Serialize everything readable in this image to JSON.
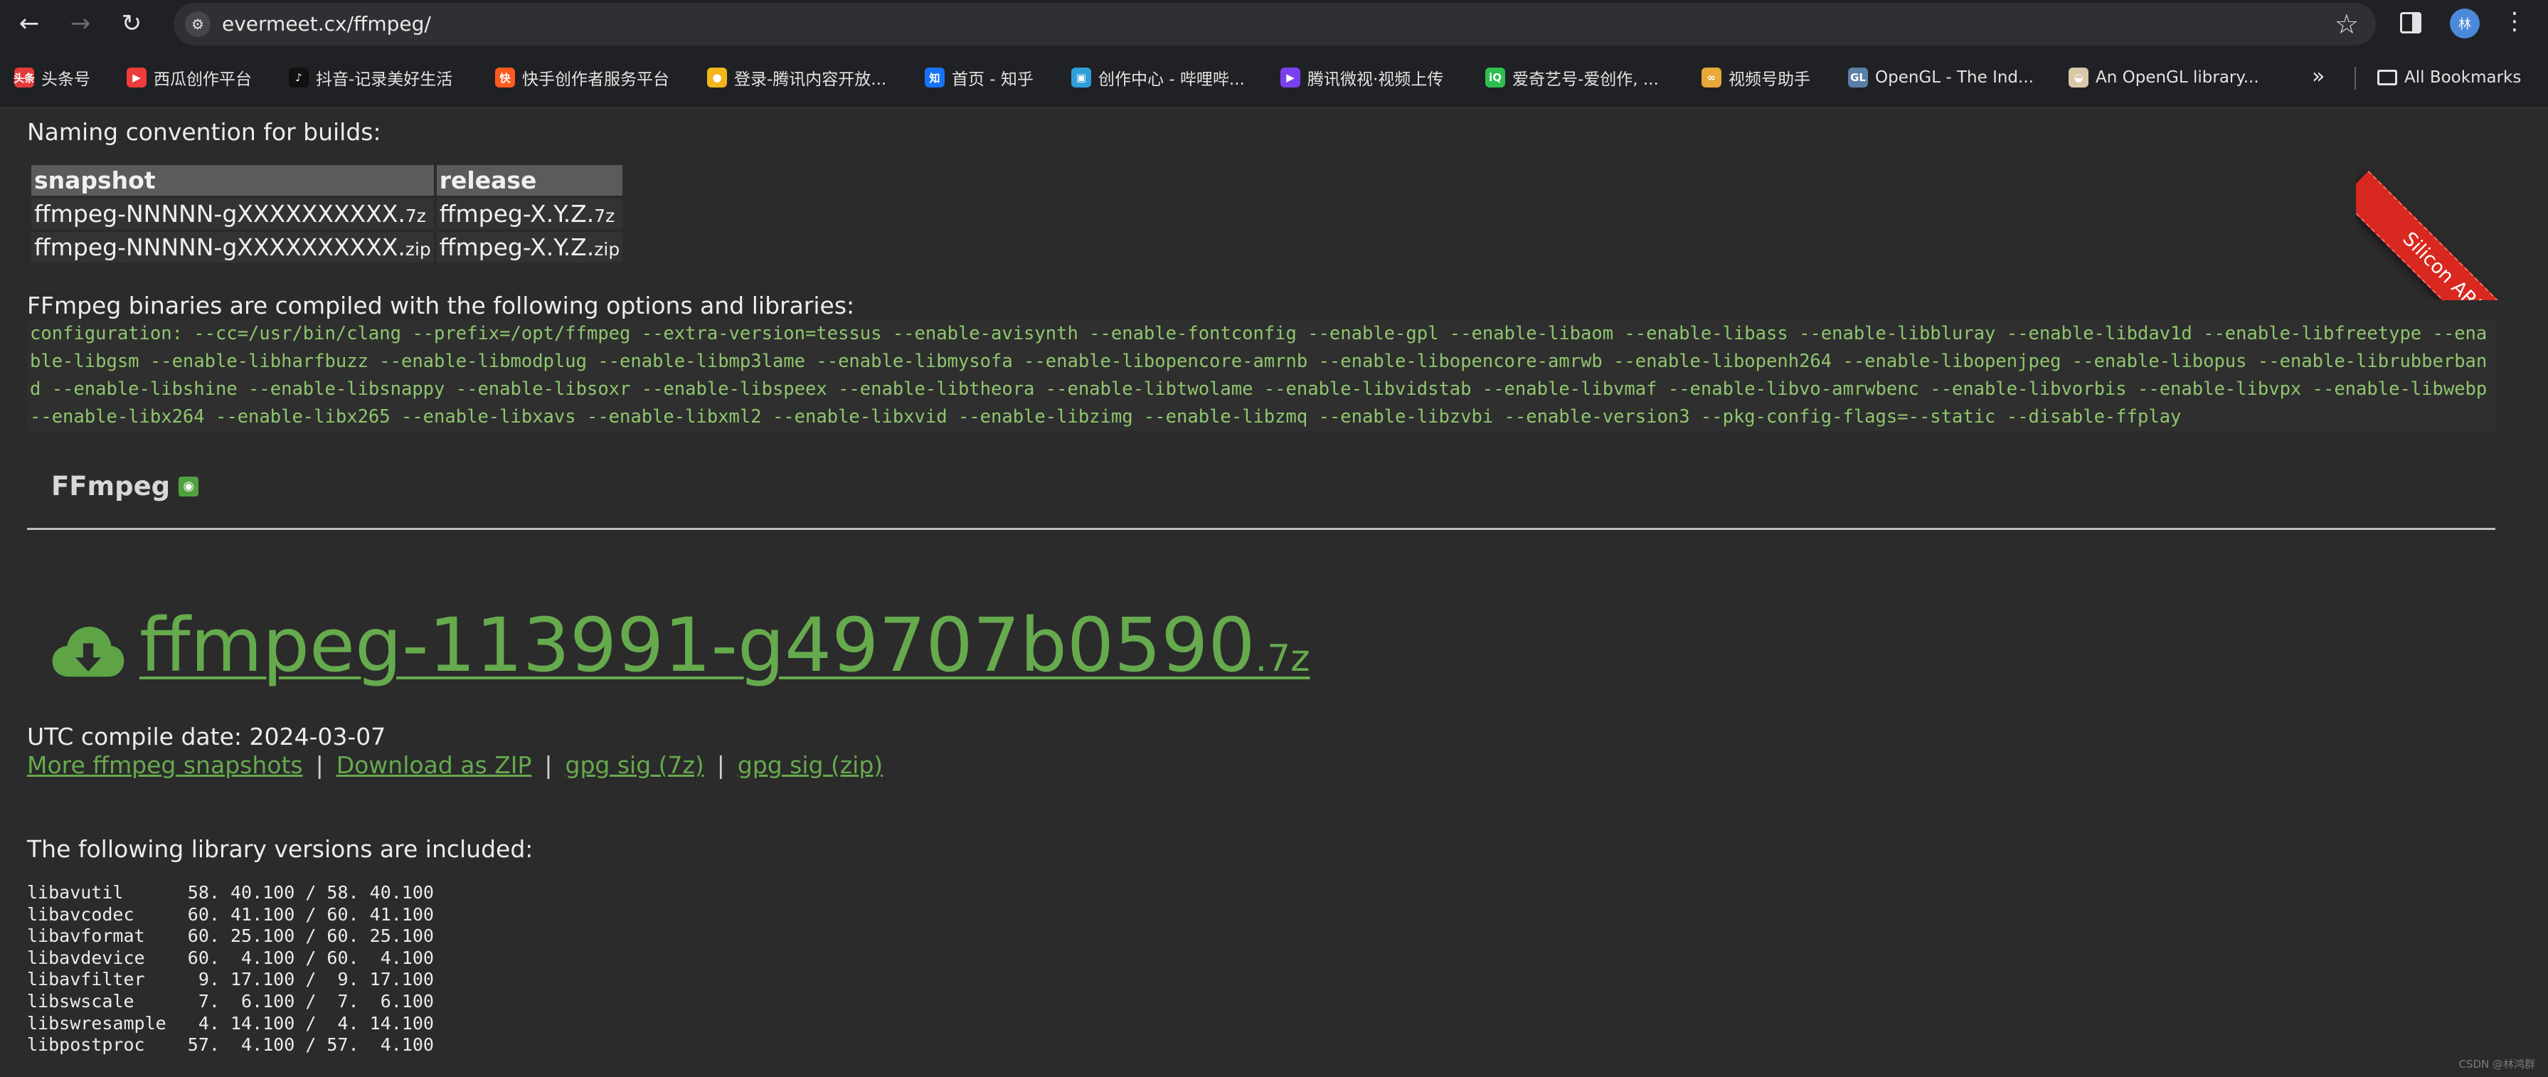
{
  "browser": {
    "url": "evermeet.cx/ffmpeg/",
    "avatar_initial": "林",
    "bookmarks": [
      {
        "label": "头条号",
        "icon": "toutiao-icon",
        "badge": "头条",
        "color": "#e33b3b"
      },
      {
        "label": "西瓜创作平台",
        "icon": "xigua-icon",
        "badge": "▶",
        "color": "#ee3c3c"
      },
      {
        "label": "抖音-记录美好生活",
        "icon": "douyin-icon",
        "badge": "♪",
        "color": "#111111"
      },
      {
        "label": "快手创作者服务平台",
        "icon": "kuaishou-icon",
        "badge": "快",
        "color": "#ff5a1f"
      },
      {
        "label": "登录-腾讯内容开放...",
        "icon": "tencent-bell-icon",
        "badge": "●",
        "color": "#f2b51b"
      },
      {
        "label": "首页 - 知乎",
        "icon": "zhihu-icon",
        "badge": "知",
        "color": "#1772f6"
      },
      {
        "label": "创作中心 - 哔哩哔...",
        "icon": "bilibili-icon",
        "badge": "▣",
        "color": "#2e9fd8"
      },
      {
        "label": "腾讯微视·视频上传",
        "icon": "weishi-icon",
        "badge": "▶",
        "color": "#7b3ff2"
      },
      {
        "label": "爱奇艺号-爱创作, ...",
        "icon": "iqiyi-icon",
        "badge": "iQ",
        "color": "#2fbf4f"
      },
      {
        "label": "视频号助手",
        "icon": "channels-icon",
        "badge": "∞",
        "color": "#e6a93a"
      },
      {
        "label": "OpenGL - The Ind...",
        "icon": "opengl-icon",
        "badge": "GL",
        "color": "#5a7fa8"
      },
      {
        "label": "An OpenGL library...",
        "icon": "library-icon",
        "badge": "◒",
        "color": "#d9c8a8"
      }
    ],
    "all_bookmarks": "All Bookmarks"
  },
  "page": {
    "naming_heading": "Naming convention for builds:",
    "naming_table": {
      "headers": [
        "snapshot",
        "release"
      ],
      "rows": [
        [
          {
            "base": "ffmpeg-NNNNN-gXXXXXXXXXX.",
            "ext": "7z"
          },
          {
            "base": "ffmpeg-X.Y.Z.",
            "ext": "7z"
          }
        ],
        [
          {
            "base": "ffmpeg-NNNNN-gXXXXXXXXXX.",
            "ext": "zip"
          },
          {
            "base": "ffmpeg-X.Y.Z.",
            "ext": "zip"
          }
        ]
      ]
    },
    "options_heading": "FFmpeg binaries are compiled with the following options and libraries:",
    "configuration": " configuration: --cc=/usr/bin/clang --prefix=/opt/ffmpeg --extra-version=tessus --enable-avisynth --enable-fontconfig --enable-gpl --enable-libaom --enable-libass --enable-libbluray --enable-libdav1d --enable-libfreetype --enable-libgsm --enable-libharfbuzz --enable-libmodplug --enable-libmp3lame --enable-libmysofa --enable-libopencore-amrnb --enable-libopencore-amrwb --enable-libopenh264 --enable-libopenjpeg --enable-libopus --enable-librubberband --enable-libshine --enable-libsnappy --enable-libsoxr --enable-libspeex --enable-libtheora --enable-libtwolame --enable-libvidstab --enable-libvmaf --enable-libvo-amrwbenc --enable-libvorbis --enable-libvpx --enable-libwebp --enable-libx264 --enable-libx265 --enable-libxavs --enable-libxml2 --enable-libxvid --enable-libzimg --enable-libzmq --enable-libzvbi --enable-version3 --pkg-config-flags=--static --disable-ffplay",
    "section_title": "FFmpeg",
    "download": {
      "name": "ffmpeg-113991-g49707b0590",
      "ext": ".7z"
    },
    "compile_date": "UTC compile date: 2024-03-07",
    "links": [
      "More ffmpeg snapshots",
      "Download as ZIP",
      "gpg sig (7z)",
      "gpg sig (zip)"
    ],
    "link_separator": "|",
    "versions_heading": "The following library versions are included:",
    "versions": [
      "libavutil      58. 40.100 / 58. 40.100",
      "libavcodec     60. 41.100 / 60. 41.100",
      "libavformat    60. 25.100 / 60. 25.100",
      "libavdevice    60.  4.100 / 60.  4.100",
      "libavfilter     9. 17.100 /  9. 17.100",
      "libswscale      7.  6.100 /  7.  6.100",
      "libswresample   4. 14.100 /  4. 14.100",
      "libpostproc    57.  4.100 / 57.  4.100"
    ],
    "ribbon": "Silicon ARM Info",
    "watermark": "CSDN @林鸿群"
  }
}
